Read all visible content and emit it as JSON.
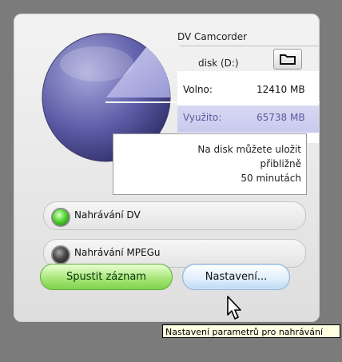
{
  "device": {
    "title": "DV Camcorder",
    "drive": "disk (D:)"
  },
  "stats": {
    "free_label": "Volno:",
    "free_value": "12410 MB",
    "used_label": "Využito:",
    "used_value": "65738 MB"
  },
  "note": {
    "line1": "Na disk můžete uložit",
    "line2": "přibližně",
    "line3": "50 minutách"
  },
  "modes": [
    {
      "label": "Nahrávání DV",
      "selected": true
    },
    {
      "label": "Nahrávání MPEGu",
      "selected": false
    }
  ],
  "buttons": {
    "start": "Spustit záznam",
    "settings": "Nastavení..."
  },
  "tooltip": "Nastavení parametrů pro nahrávání",
  "colors": {
    "used": "#c9c9ee",
    "led_on": "#39c21f",
    "led_off": "#3b3b3b"
  },
  "icons": {
    "folder": "folder-icon",
    "cursor": "arrow-cursor-icon"
  }
}
